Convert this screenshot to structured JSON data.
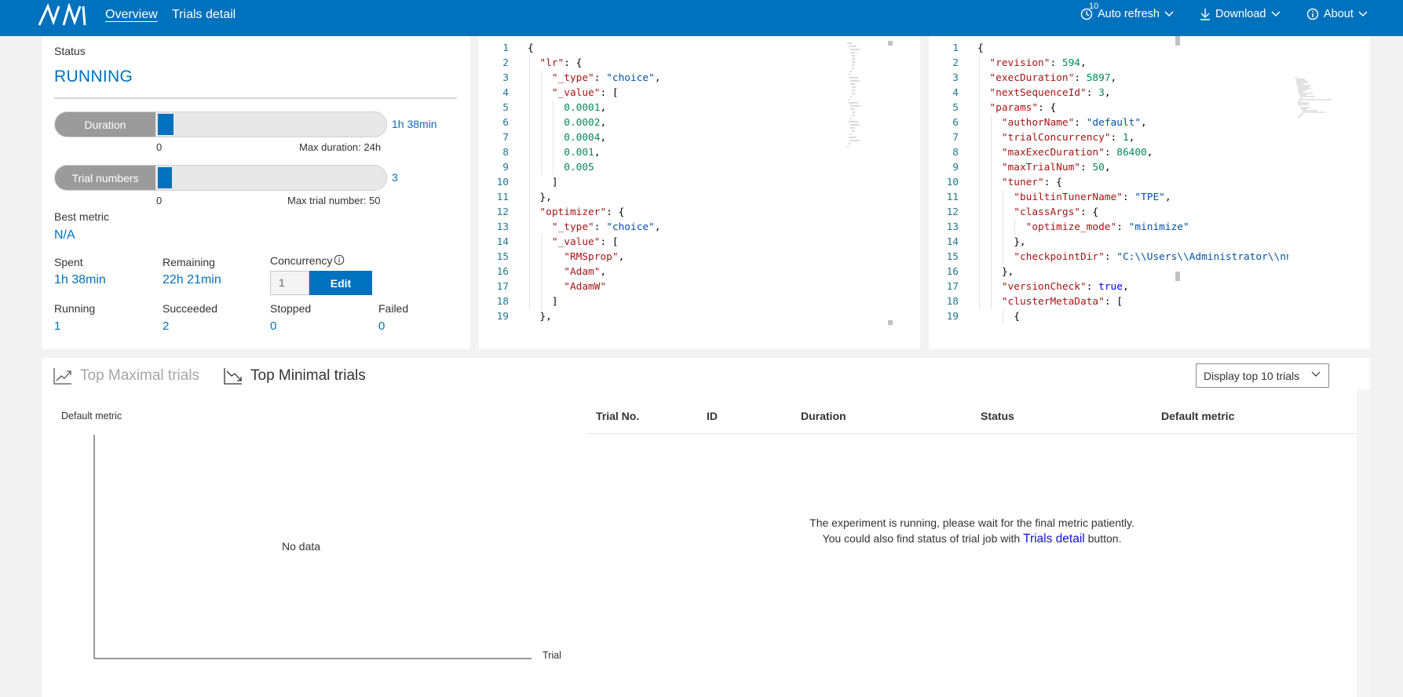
{
  "header": {
    "nav": [
      "Overview",
      "Trials detail"
    ],
    "refresh_interval": "10",
    "auto_refresh": "Auto refresh",
    "download": "Download",
    "about": "About",
    "brand_color": "#0071bc"
  },
  "status": {
    "label": "Status",
    "value": "RUNNING",
    "duration": {
      "label": "Duration",
      "value": "1h 38min",
      "min": "0",
      "max_label": "Max duration: 24h",
      "progress_fraction": 0.068
    },
    "trials": {
      "label": "Trial numbers",
      "value": "3",
      "min": "0",
      "max_label": "Max trial number: 50",
      "progress_fraction": 0.06
    },
    "best_metric": {
      "label": "Best metric",
      "value": "N/A"
    },
    "spent": {
      "label": "Spent",
      "value": "1h 38min"
    },
    "remaining": {
      "label": "Remaining",
      "value": "22h 21min"
    },
    "concurrency": {
      "label": "Concurrency",
      "input_value": "1",
      "edit_label": "Edit"
    },
    "counts": [
      {
        "label": "Running",
        "value": "1"
      },
      {
        "label": "Succeeded",
        "value": "2"
      },
      {
        "label": "Stopped",
        "value": "0"
      },
      {
        "label": "Failed",
        "value": "0"
      }
    ]
  },
  "search_space_editor": {
    "line_numbers": [
      "1",
      "2",
      "3",
      "4",
      "5",
      "6",
      "7",
      "8",
      "9",
      "10",
      "11",
      "12",
      "13",
      "14",
      "15",
      "16",
      "17",
      "18",
      "19"
    ]
  },
  "config_editor": {
    "line_numbers": [
      "1",
      "2",
      "3",
      "4",
      "5",
      "6",
      "7",
      "8",
      "9",
      "10",
      "11",
      "12",
      "13",
      "14",
      "15",
      "16",
      "17",
      "18",
      "19"
    ]
  },
  "trials_panel": {
    "tabs": [
      "Top Maximal trials",
      "Top Minimal trials"
    ],
    "display_select": "Display top 10 trials",
    "chart": {
      "y_label": "Default metric",
      "x_label": "Trial",
      "empty_text": "No data"
    },
    "table_headers": [
      "Trial No.",
      "ID",
      "Duration",
      "Status",
      "Default metric"
    ],
    "empty_message_line1": "The experiment is running, please wait for the final metric patiently.",
    "empty_message_prefix": "You could also find status of trial job with",
    "empty_message_link": "Trials detail",
    "empty_message_suffix": "button."
  }
}
